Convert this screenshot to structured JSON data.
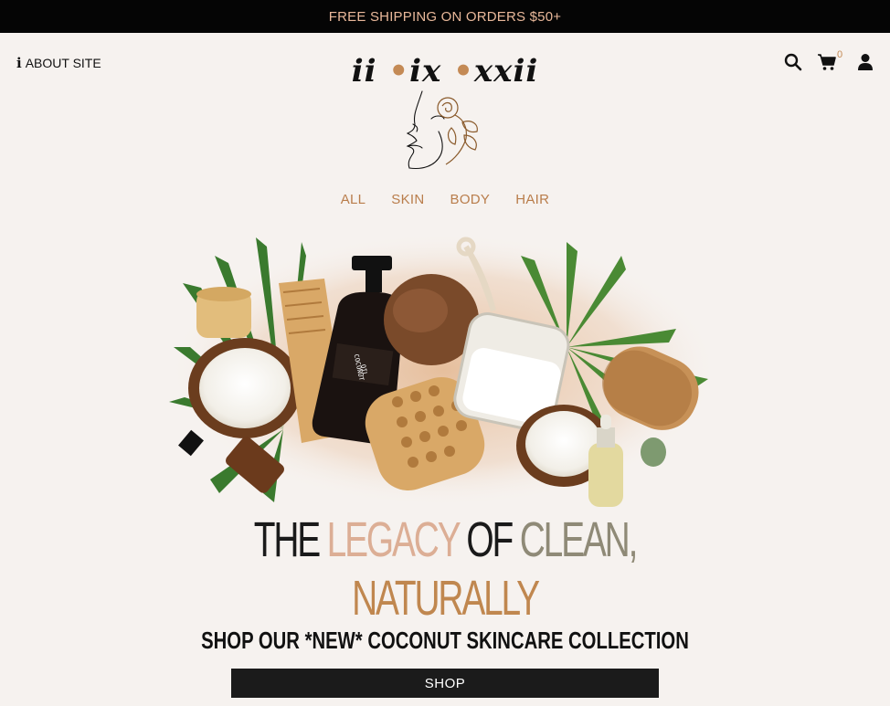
{
  "promo": {
    "text": "FREE SHIPPING ON ORDERS $50+"
  },
  "header": {
    "about_label": "ABOUT SITE",
    "brand": {
      "part1": "ii",
      "dot": "•",
      "part2": "ix",
      "part3": "xxii"
    },
    "cart_count": "0"
  },
  "nav": {
    "items": [
      "ALL",
      "SKIN",
      "BODY",
      "HAIR"
    ]
  },
  "hero": {
    "line1": {
      "w1": "THE",
      "w2": "LEGACY",
      "w3": "OF",
      "w4": "CLEAN,"
    },
    "line2": "NATURALLY",
    "line3": {
      "pre": "SHOP OUR",
      "new": "*NEW*",
      "post": "COCONUT SKINCARE COLLECTION"
    },
    "bottle_label_1": "COCONUT",
    "bottle_label_2": "OIL",
    "shop_button": "SHOP"
  },
  "colors": {
    "promo_bg": "#050505",
    "promo_text": "#e9b89a",
    "page_bg": "#f6f2ef",
    "accent_brown": "#c48a55",
    "accent_pink": "#dcae95",
    "accent_olive": "#8f8a77",
    "button_bg": "#1b1b1b"
  },
  "icons": [
    "info-icon",
    "search-icon",
    "cart-icon",
    "user-icon",
    "face-rose-logo"
  ]
}
